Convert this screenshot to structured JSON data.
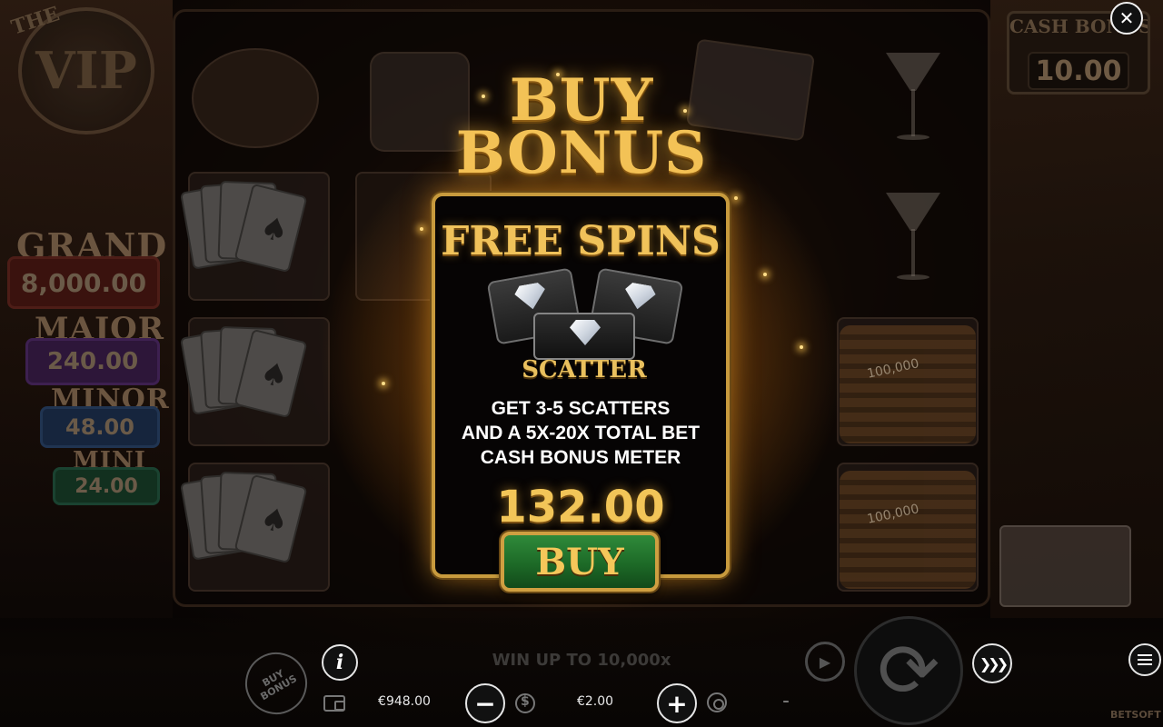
{
  "game": {
    "logo_the": "THE",
    "logo_vip": "VIP"
  },
  "jackpots": {
    "grand_label": "GRAND",
    "grand_value": "8,000.00",
    "major_label": "MAJOR",
    "major_value": "240.00",
    "minor_label": "MINOR",
    "minor_value": "48.00",
    "mini_label": "MINI",
    "mini_value": "24.00"
  },
  "cash_bonus": {
    "label": "CASH BONUS",
    "value": "10.00"
  },
  "reel_symbols": {
    "chips_text": "100,000"
  },
  "dialog": {
    "title_line1": "BUY",
    "title_line2": "BONUS",
    "feature_title": "FREE SPINS",
    "scatter_label": "SCATTER",
    "desc_line1": "GET 3-5 SCATTERS",
    "desc_line2": "AND A 5X-20X TOTAL BET",
    "desc_line3": "CASH BONUS METER",
    "price": "132.00",
    "buy_label": "BUY",
    "close_symbol": "✕"
  },
  "bottom_bar": {
    "buy_bonus_line1": "BUY",
    "buy_bonus_line2": "BONUS",
    "info_symbol": "i",
    "balance": "€948.00",
    "win_up_to": "WIN UP TO 10,000x",
    "bet": "€2.00",
    "win": "–",
    "minus_symbol": "−",
    "plus_symbol": "+",
    "spin_symbol": "⟳",
    "turbo_symbol": "❯❯❯",
    "provider": "BETSOFT"
  },
  "colors": {
    "gold": "#f3c256",
    "buy_button_green": "#1d6a27",
    "panel_border": "#c79a3d"
  },
  "icons": [
    "close-icon",
    "info-icon",
    "wallet-icon",
    "minus-icon",
    "coins-icon",
    "plus-icon",
    "medal-icon",
    "autoplay-icon",
    "spin-icon",
    "turbo-icon",
    "menu-icon",
    "diamond-icon"
  ]
}
